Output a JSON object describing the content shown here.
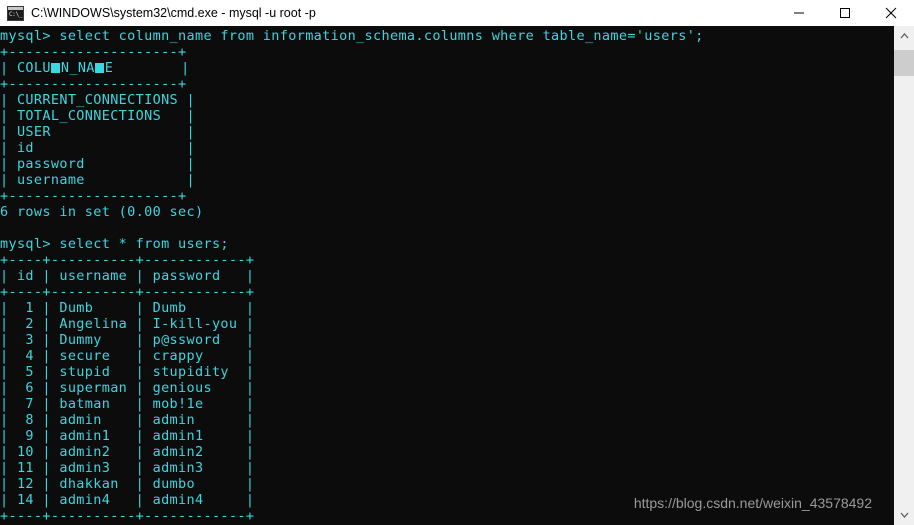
{
  "window": {
    "title": "C:\\WINDOWS\\system32\\cmd.exe - mysql  -u root -p",
    "icon": "cmd-console-icon",
    "minimize_label": "—",
    "maximize_label": "□",
    "close_label": "✕",
    "background": "#0c0c0c",
    "text_color": "#3bd6e0"
  },
  "watermark": {
    "text": "https://blog.csdn.net/weixin_43578492"
  },
  "scrollbar": {
    "up_arrow": "˄",
    "down_arrow": "˅",
    "thumb_color": "#cdcdcd",
    "track_color": "#f0f0f0"
  },
  "terminal": {
    "prompt": "mysql>",
    "query1": "mysql> select column_name from information_schema.columns where table_name='users';",
    "query1_sep_top": "+--------------------+",
    "query1_header": "| COLUMN_NAME        |",
    "query1_sep_mid": "+--------------------+",
    "query1_rows": [
      "| CURRENT_CONNECTIONS |",
      "| TOTAL_CONNECTIONS   |",
      "| USER                |",
      "| id                  |",
      "| password            |",
      "| username            |"
    ],
    "query1_columns": [
      "CURRENT_CONNECTIONS",
      "TOTAL_CONNECTIONS",
      "USER",
      "id",
      "password",
      "username"
    ],
    "query1_sep_bottom": "+--------------------+",
    "query1_status": "6 rows in set (0.00 sec)",
    "query2": "mysql> select * from users;",
    "query2_sep": "+----+----------+------------+",
    "query2_headers": [
      "id",
      "username",
      "password"
    ],
    "query2_header_line": "| id | username | password   |",
    "query2_rows": [
      {
        "id": "1",
        "username": "Dumb",
        "password": "Dumb"
      },
      {
        "id": "2",
        "username": "Angelina",
        "password": "I-kill-you"
      },
      {
        "id": "3",
        "username": "Dummy",
        "password": "p@ssword"
      },
      {
        "id": "4",
        "username": "secure",
        "password": "crappy"
      },
      {
        "id": "5",
        "username": "stupid",
        "password": "stupidity"
      },
      {
        "id": "6",
        "username": "superman",
        "password": "genious"
      },
      {
        "id": "7",
        "username": "batman",
        "password": "mob!1e"
      },
      {
        "id": "8",
        "username": "admin",
        "password": "admin"
      },
      {
        "id": "9",
        "username": "admin1",
        "password": "admin1"
      },
      {
        "id": "10",
        "username": "admin2",
        "password": "admin2"
      },
      {
        "id": "11",
        "username": "admin3",
        "password": "admin3"
      },
      {
        "id": "12",
        "username": "dhakkan",
        "password": "dumbo"
      },
      {
        "id": "14",
        "username": "admin4",
        "password": "admin4"
      }
    ]
  }
}
